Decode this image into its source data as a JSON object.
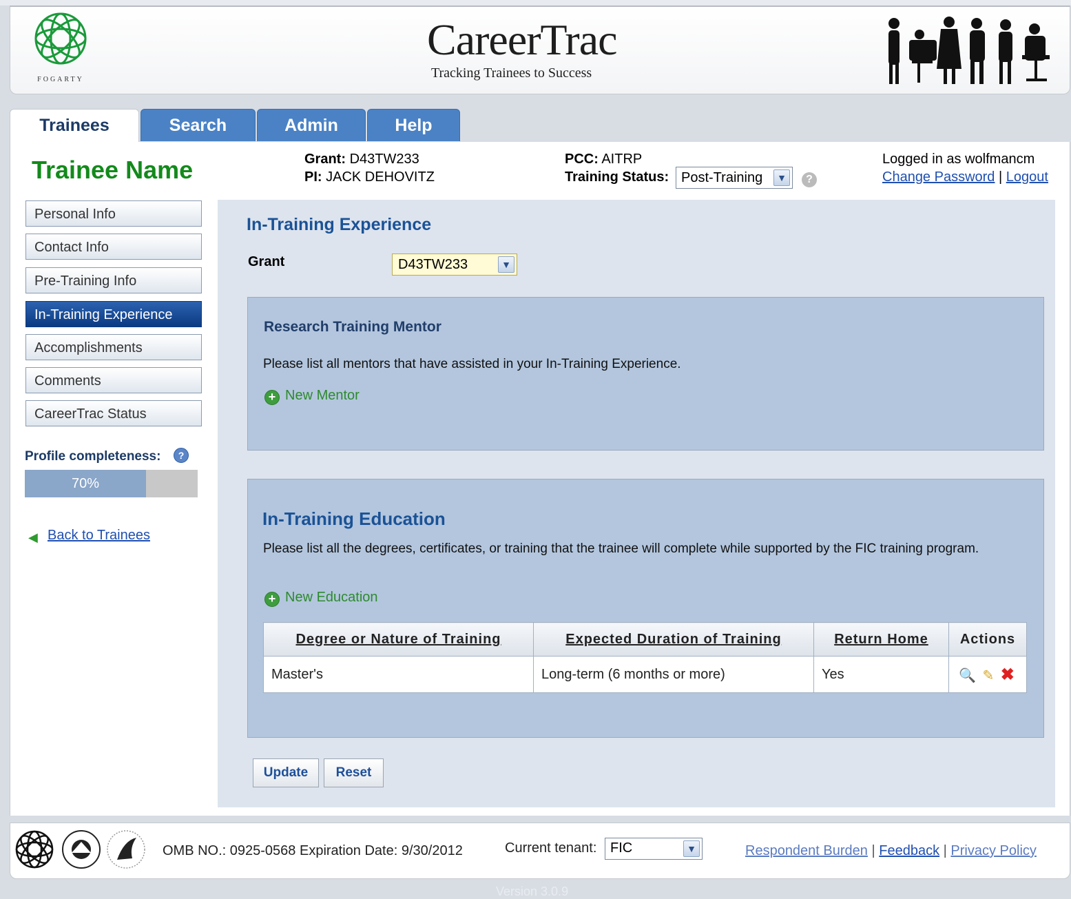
{
  "header": {
    "logo_text": "FOGARTY",
    "brand_title": "CareerTrac",
    "brand_subtitle": "Tracking Trainees to Success"
  },
  "tabs": [
    {
      "label": "Trainees",
      "active": true
    },
    {
      "label": "Search",
      "active": false
    },
    {
      "label": "Admin",
      "active": false
    },
    {
      "label": "Help",
      "active": false
    }
  ],
  "trainee": {
    "name": "Trainee Name",
    "grant_label": "Grant:",
    "grant_value": "D43TW233",
    "pi_label": "PI:",
    "pi_value": "JACK DEHOVITZ",
    "pcc_label": "PCC:",
    "pcc_value": "AITRP",
    "status_label": "Training Status:",
    "status_value": "Post-Training"
  },
  "account": {
    "logged_in_text": "Logged in as wolfmancm",
    "change_password": "Change Password",
    "separator": "|",
    "logout": "Logout"
  },
  "sidebar": {
    "items": [
      {
        "label": "Personal Info",
        "active": false
      },
      {
        "label": "Contact Info",
        "active": false
      },
      {
        "label": "Pre-Training Info",
        "active": false
      },
      {
        "label": "In-Training Experience",
        "active": true
      },
      {
        "label": "Accomplishments",
        "active": false
      },
      {
        "label": "Comments",
        "active": false
      },
      {
        "label": "CareerTrac Status",
        "active": false
      }
    ],
    "profile_label": "Profile completeness:",
    "profile_percent_text": "70%",
    "profile_fraction": 0.7,
    "back_link": "Back to Trainees"
  },
  "main": {
    "heading": "In-Training Experience",
    "grant_label": "Grant",
    "grant_value": "D43TW233",
    "mentor": {
      "title": "Research Training Mentor",
      "description": "Please list all mentors that have assisted in your In-Training Experience.",
      "add_label": "New Mentor"
    },
    "education": {
      "title": "In-Training Education",
      "description": "Please list all the degrees, certificates, or training that the trainee will complete while supported by the FIC training program.",
      "add_label": "New Education",
      "columns": [
        "Degree or Nature of Training",
        "Expected Duration of Training",
        "Return Home",
        "Actions"
      ],
      "rows": [
        {
          "degree": "Master's",
          "duration": "Long-term (6 months or more)",
          "return_home": "Yes"
        }
      ]
    },
    "update_label": "Update",
    "reset_label": "Reset"
  },
  "footer": {
    "omb_text": "OMB NO.: 0925-0568 Expiration Date: 9/30/2012",
    "tenant_label": "Current tenant:",
    "tenant_value": "FIC",
    "links": [
      "Respondent Burden",
      "Feedback",
      "Privacy Policy"
    ],
    "separator": "|",
    "version": "Version 3.0.9"
  },
  "icons": {
    "status_help": "question-icon",
    "profile_help": "question-icon",
    "back": "left-arrow-icon",
    "add": "plus-circle-icon",
    "view": "magnifier-icon",
    "edit": "pencil-icon",
    "delete": "red-x-icon"
  },
  "colors": {
    "brand_green": "#138a1b",
    "tab_blue": "#4a82c5",
    "heading_blue": "#1b5296",
    "section_bg": "#b3c6de",
    "active_nav": "#0b3a82"
  }
}
